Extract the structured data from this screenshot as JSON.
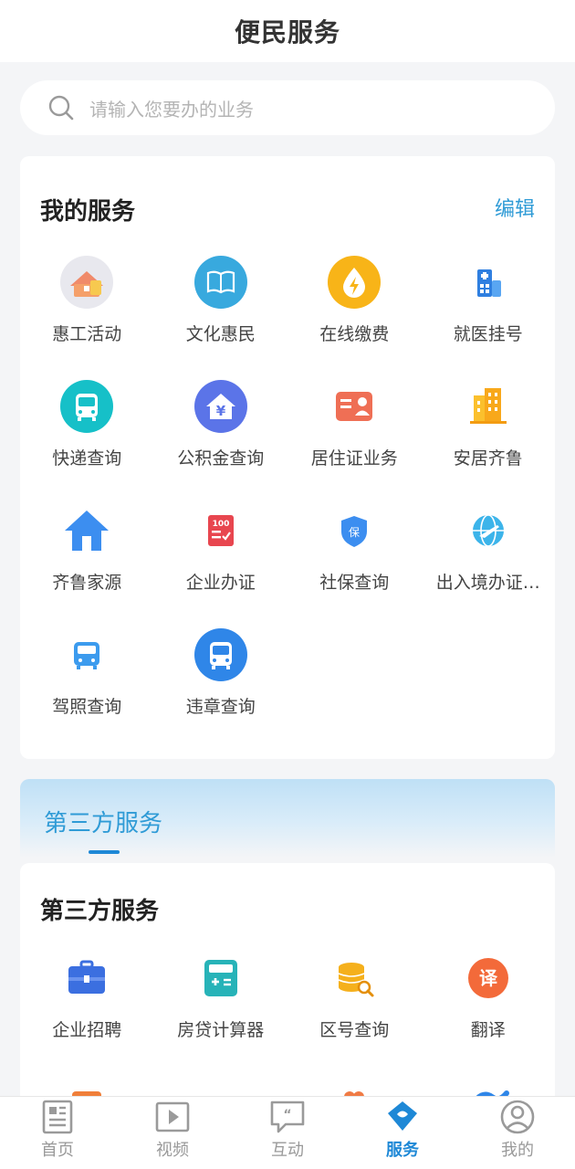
{
  "header": {
    "title": "便民服务"
  },
  "search": {
    "placeholder": "请输入您要办的业务"
  },
  "my_services": {
    "title": "我的服务",
    "edit_label": "编辑",
    "items": [
      {
        "label": "惠工活动",
        "icon": "gift-house-icon"
      },
      {
        "label": "文化惠民",
        "icon": "book-icon"
      },
      {
        "label": "在线缴费",
        "icon": "lightning-drop-icon"
      },
      {
        "label": "就医挂号",
        "icon": "hospital-icon"
      },
      {
        "label": "快递查询",
        "icon": "bus-icon"
      },
      {
        "label": "公积金查询",
        "icon": "yuan-house-icon"
      },
      {
        "label": "居住证业务",
        "icon": "id-card-icon"
      },
      {
        "label": "安居齐鲁",
        "icon": "building-icon"
      },
      {
        "label": "齐鲁家源",
        "icon": "home-icon"
      },
      {
        "label": "企业办证",
        "icon": "checklist-icon"
      },
      {
        "label": "社保查询",
        "icon": "shield-icon"
      },
      {
        "label": "出入境办证…",
        "icon": "plane-globe-icon"
      },
      {
        "label": "驾照查询",
        "icon": "small-bus-icon"
      },
      {
        "label": "违章查询",
        "icon": "bus-circle-icon"
      }
    ]
  },
  "third_party_banner": {
    "title": "第三方服务"
  },
  "third_party": {
    "title": "第三方服务",
    "items": [
      {
        "label": "企业招聘",
        "icon": "briefcase-icon"
      },
      {
        "label": "房贷计算器",
        "icon": "calculator-icon"
      },
      {
        "label": "区号查询",
        "icon": "coins-search-icon"
      },
      {
        "label": "翻译",
        "icon": "translate-icon"
      }
    ]
  },
  "bottom_nav": [
    {
      "label": "首页",
      "icon": "news-icon"
    },
    {
      "label": "视频",
      "icon": "video-icon"
    },
    {
      "label": "互动",
      "icon": "chat-icon"
    },
    {
      "label": "服务",
      "icon": "service-icon",
      "active": true
    },
    {
      "label": "我的",
      "icon": "user-icon"
    }
  ],
  "colors": {
    "accent": "#2f9bd6",
    "nav_active": "#1e88d6"
  }
}
